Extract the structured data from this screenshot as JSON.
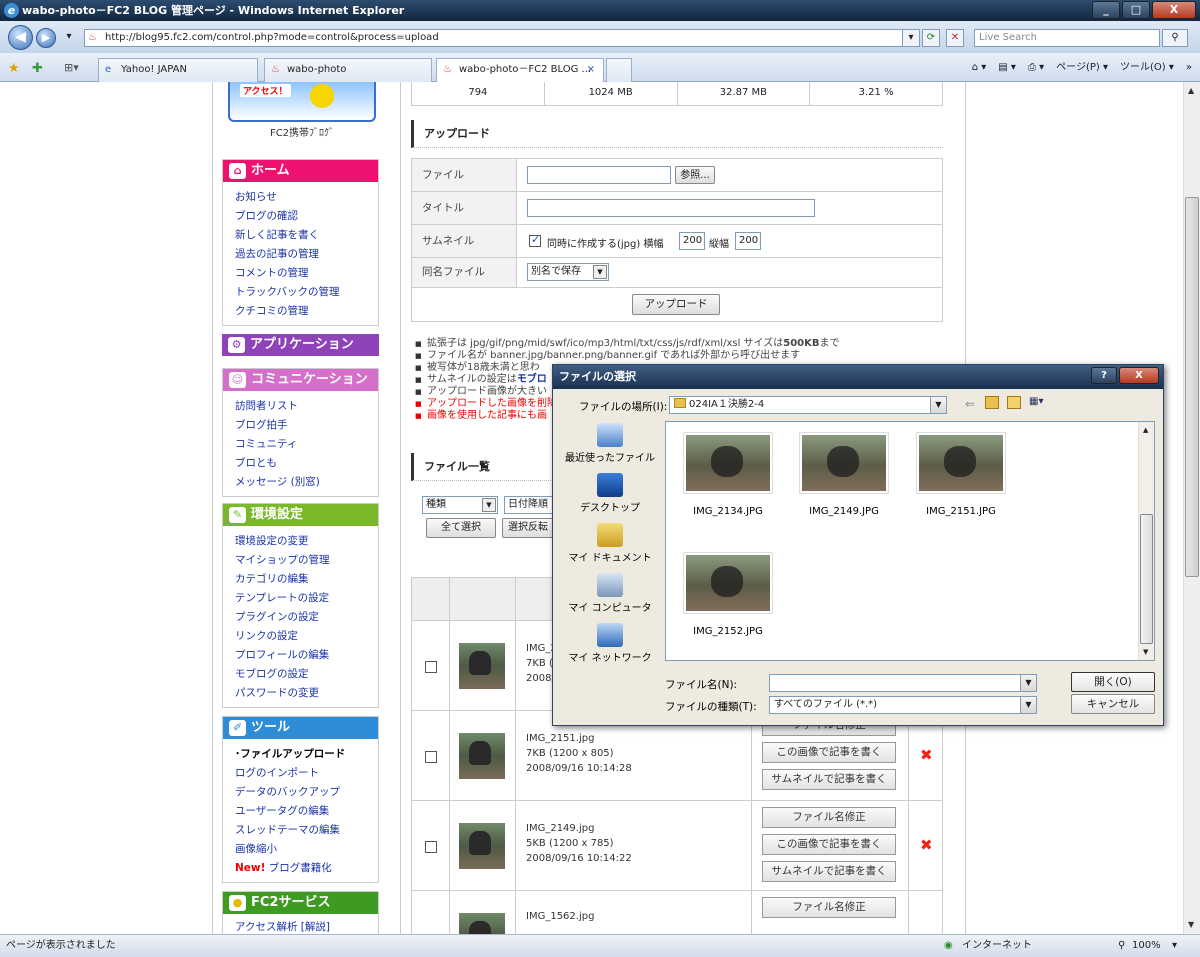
{
  "window": {
    "title": "wabo-photo－FC2 BLOG 管理ページ - Windows Internet Explorer",
    "minimize": "_",
    "maximize": "□",
    "close": "X"
  },
  "address": {
    "url": "http://blog95.fc2.com/control.php?mode=control&process=upload",
    "search_placeholder": "Live Search"
  },
  "tabs": [
    {
      "label": "Yahoo! JAPAN"
    },
    {
      "label": "wabo-photo"
    },
    {
      "label": "wabo-photo－FC2 BLOG ...",
      "active": true
    }
  ],
  "commands": {
    "page": "ページ(P) ▾",
    "tools": "ツール(O) ▾"
  },
  "sidebar": {
    "banner_text": "アクセス！",
    "banner_caption": "FC2携帯ﾌﾞﾛｸﾞ",
    "home": {
      "title": "ホーム",
      "items": [
        "お知らせ",
        "ブログの確認",
        "新しく記事を書く",
        "過去の記事の管理",
        "コメントの管理",
        "トラックバックの管理",
        "クチコミの管理"
      ]
    },
    "apps": {
      "title": "アプリケーション"
    },
    "community": {
      "title": "コミュニケーション",
      "items": [
        "訪問者リスト",
        "ブログ拍手",
        "コミュニティ",
        "ブロとも",
        "メッセージ (別窓)"
      ]
    },
    "settings": {
      "title": "環境設定",
      "items": [
        "環境設定の変更",
        "マイショップの管理",
        "カテゴリの編集",
        "テンプレートの設定",
        "プラグインの設定",
        "リンクの設定",
        "プロフィールの編集",
        "モブログの設定",
        "パスワードの変更"
      ]
    },
    "tools": {
      "title": "ツール",
      "items": [
        "･ファイルアップロード",
        "ログのインポート",
        "データのバックアップ",
        "ユーザータグの編集",
        "スレッドテーマの編集",
        "画像縮小"
      ],
      "new_badge": "New!",
      "new_item": "ブログ書籍化"
    },
    "services": {
      "title": "FC2サービス",
      "first_item": "アクセス解析 [解説]"
    }
  },
  "stats": [
    "794",
    "1024 MB",
    "32.87 MB",
    "3.21 %"
  ],
  "upload": {
    "title": "アップロード",
    "file_label": "ファイル",
    "browse": "参照...",
    "title_label": "タイトル",
    "thumb_label": "サムネイル",
    "thumb_check": "同時に作成する(jpg) 横幅",
    "width_label": "縦幅",
    "thumb_width": "200",
    "thumb_height": "200",
    "same_label": "同名ファイル",
    "same_value": "別名で保存",
    "submit": "アップロード"
  },
  "notes": [
    {
      "text": "拡張子は jpg/gif/png/mid/swf/ico/mp3/html/txt/css/js/rdf/xml/xsl サイズは",
      "bold": "500KB",
      "suffix": "まで"
    },
    {
      "text": "ファイル名が banner.jpg/banner.png/banner.gif であれば外部から呼び出せます"
    },
    {
      "text": "被写体が18歳未満と思わ"
    },
    {
      "text": "サムネイルの設定は",
      "blue": "モブロ"
    },
    {
      "text": "アップロード画像が大きい"
    },
    {
      "text": "アップロードした画像を削除",
      "red": true
    },
    {
      "text": "画像を使用した記事にも画",
      "red": true
    }
  ],
  "filelist": {
    "title": "ファイル一覧",
    "sort_type": "種類",
    "sort_order": "日付降順",
    "select_all": "全て選択",
    "invert": "選択反転",
    "rows": [
      {
        "name": "IMG_2",
        "size": "7KB (",
        "date": "2008/"
      },
      {
        "name": "IMG_2151.jpg",
        "size": "7KB (1200 x 805)",
        "date": "2008/09/16 10:14:28"
      },
      {
        "name": "IMG_2149.jpg",
        "size": "5KB (1200 x 785)",
        "date": "2008/09/16 10:14:22"
      },
      {
        "name": "IMG_1562.jpg",
        "size": "",
        "date": ""
      }
    ],
    "rename": "ファイル名修正",
    "write_image": "この画像で記事を書く",
    "write_thumb": "サムネイルで記事を書く",
    "delete": "✖"
  },
  "dialog": {
    "title": "ファイルの選択",
    "help": "?",
    "close": "X",
    "location_label": "ファイルの場所(I):",
    "location": "024IA１決勝2-4",
    "places": [
      "最近使ったファイル",
      "デスクトップ",
      "マイ ドキュメント",
      "マイ コンピュータ",
      "マイ ネットワーク"
    ],
    "files": [
      "IMG_2134.JPG",
      "IMG_2149.JPG",
      "IMG_2151.JPG",
      "IMG_2152.JPG"
    ],
    "filename_label": "ファイル名(N):",
    "filetype_label": "ファイルの種類(T):",
    "filetype": "すべてのファイル (*.*)",
    "open": "開く(O)",
    "cancel": "キャンセル"
  },
  "status": {
    "text": "ページが表示されました",
    "zone": "インターネット",
    "zoom": "100%"
  },
  "colors": {
    "home": "#ee1170",
    "apps": "#8e44b8",
    "community": "#d56fc9",
    "settings": "#7ab82a",
    "tools": "#2f8cd6",
    "services": "#3f9a22"
  }
}
